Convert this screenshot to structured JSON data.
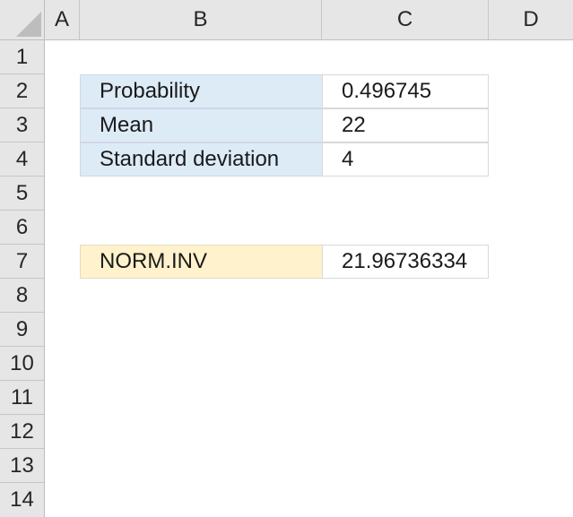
{
  "columns": [
    "A",
    "B",
    "C",
    "D"
  ],
  "rows": [
    "1",
    "2",
    "3",
    "4",
    "5",
    "6",
    "7",
    "8",
    "9",
    "10",
    "11",
    "12",
    "13",
    "14"
  ],
  "cells": {
    "B2": "Probability",
    "C2": "0.496745",
    "B3": "Mean",
    "C3": "22",
    "B4": "Standard deviation",
    "C4": "4",
    "B7": "NORM.INV",
    "C7": "21.96736334"
  },
  "colors": {
    "input_label_fill": "#ddebf7",
    "result_label_fill": "#fff2cc",
    "header_fill": "#e6e6e6"
  }
}
